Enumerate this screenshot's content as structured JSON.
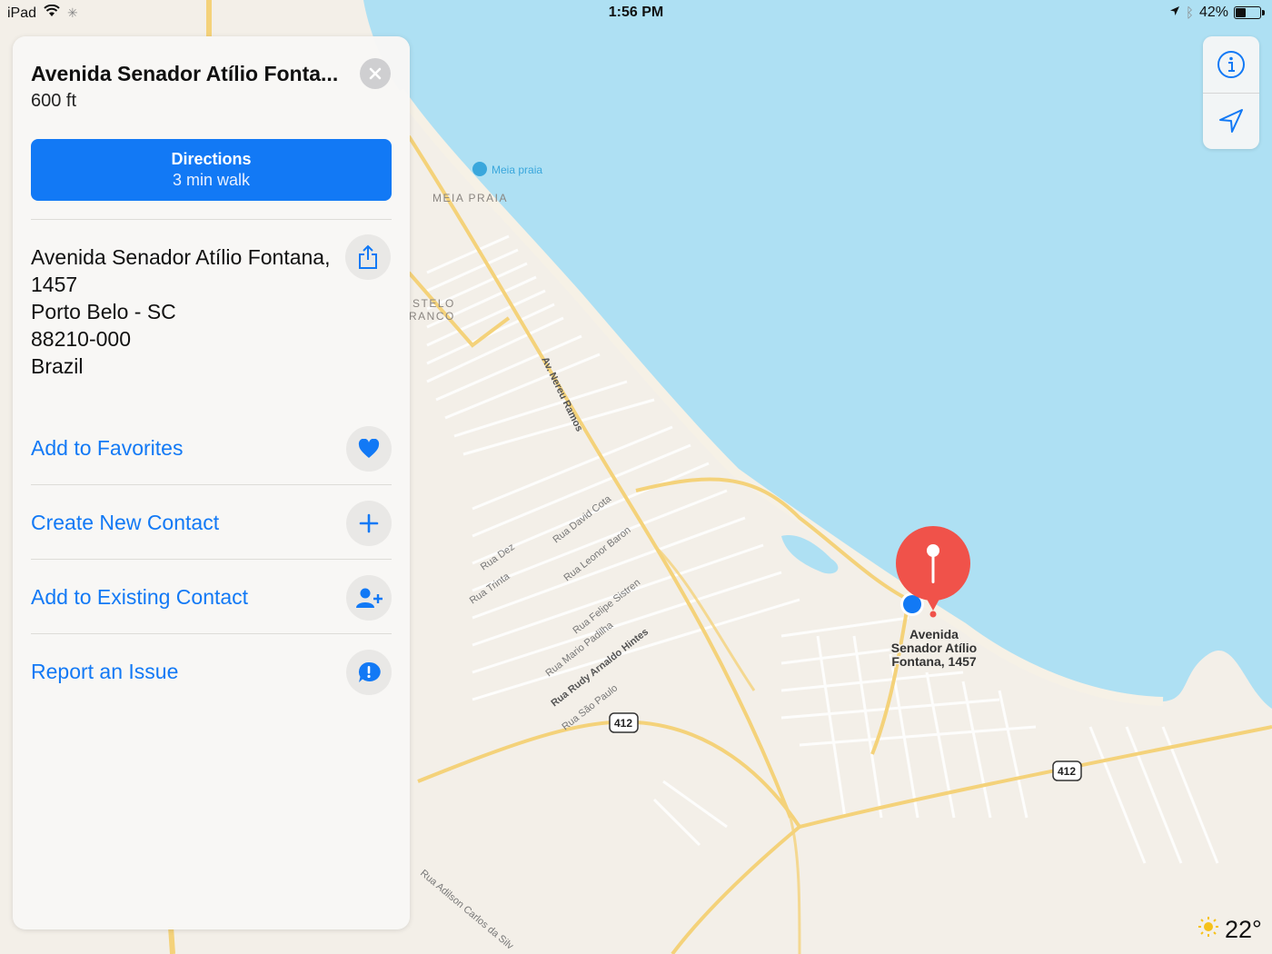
{
  "status_bar": {
    "device": "iPad",
    "time": "1:56 PM",
    "battery_text": "42%",
    "battery_level": 0.42
  },
  "panel": {
    "title": "Avenida Senador Atílio Fonta...",
    "distance": "600 ft",
    "directions": {
      "label": "Directions",
      "sublabel": "3 min walk"
    },
    "address": {
      "line1": "Avenida Senador Atílio Fontana, 1457",
      "line2": "Porto Belo - SC",
      "line3": "88210-000",
      "line4": "Brazil"
    },
    "actions": [
      {
        "label": "Add to Favorites",
        "icon": "heart-icon"
      },
      {
        "label": "Create New Contact",
        "icon": "plus-icon"
      },
      {
        "label": "Add to Existing Contact",
        "icon": "add-person-icon"
      },
      {
        "label": "Report an Issue",
        "icon": "exclamation-bubble-icon"
      }
    ]
  },
  "map": {
    "pin_label": [
      "Avenida",
      "Senador Atílio",
      "Fontana, 1457"
    ],
    "beach_poi": "Meia praia",
    "district_label": "MEIA PRAIA",
    "district_label_2": [
      "STELO",
      "RANCO"
    ],
    "highway_shields": [
      "412",
      "412"
    ],
    "streets": {
      "nereu": "Av. Nereu Ramos",
      "david": "Rua David Cota",
      "leonor": "Rua Leonor Baron",
      "dez": "Rua Dez",
      "trinta": "Rua Trinta",
      "felipe": "Rua Felipe Sistren",
      "mario": "Rua Mario Padilha",
      "rudy": "Rua Rudy Arnaldo Hintes",
      "saopaulo": "Rua São Paulo",
      "adilson": "Rua Adilson Carlos da Silv"
    },
    "colors": {
      "water": "#aee0f3",
      "land": "#f3efe8",
      "road_major": "#f4d27a",
      "pin": "#f0524a",
      "user_location": "#1279f5"
    }
  },
  "map_controls": {
    "info_icon": "info-icon",
    "location_icon": "location-arrow-icon"
  },
  "weather": {
    "temperature": "22°",
    "icon": "sun-icon"
  }
}
